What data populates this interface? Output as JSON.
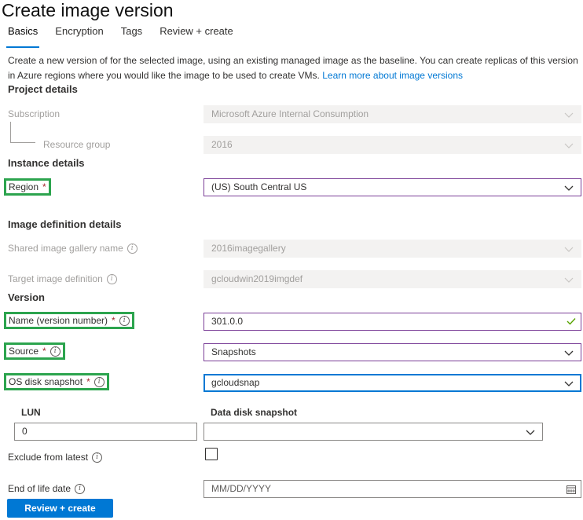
{
  "page": {
    "title": "Create image version",
    "tabs": [
      {
        "label": "Basics",
        "active": true
      },
      {
        "label": "Encryption"
      },
      {
        "label": "Tags"
      },
      {
        "label": "Review + create"
      }
    ],
    "description": "Create a new version of for the selected image, using an existing managed image as the baseline. You can create replicas of this version in Azure regions where you would like the image to be used to create VMs.",
    "learn_more": "Learn more about image versions"
  },
  "project": {
    "heading": "Project details",
    "subscription_label": "Subscription",
    "subscription_value": "Microsoft Azure Internal Consumption",
    "resource_group_label": "Resource group",
    "resource_group_value": "2016"
  },
  "instance": {
    "heading": "Instance details",
    "region_label": "Region",
    "region_value": "(US) South Central US"
  },
  "image_definition": {
    "heading": "Image definition details",
    "gallery_label": "Shared image gallery name",
    "gallery_value": "2016imagegallery",
    "target_label": "Target image definition",
    "target_value": "gcloudwin2019imgdef"
  },
  "version": {
    "heading": "Version",
    "name_label": "Name (version number)",
    "name_value": "301.0.0",
    "source_label": "Source",
    "source_value": "Snapshots",
    "os_disk_label": "OS disk snapshot",
    "os_disk_value": "gcloudsnap",
    "lun_header": "LUN",
    "data_disk_header": "Data disk snapshot",
    "lun_value": "0",
    "data_disk_value": "",
    "exclude_label": "Exclude from latest",
    "exclude_checked": false,
    "eol_label": "End of life date",
    "eol_placeholder": "MM/DD/YYYY"
  },
  "footer": {
    "review_button": "Review + create"
  },
  "required_mark": "*",
  "colors": {
    "accent": "#0078d4",
    "highlight": "#2ca44e",
    "required": "#a4262c",
    "valid_border": "#7b3f98"
  }
}
